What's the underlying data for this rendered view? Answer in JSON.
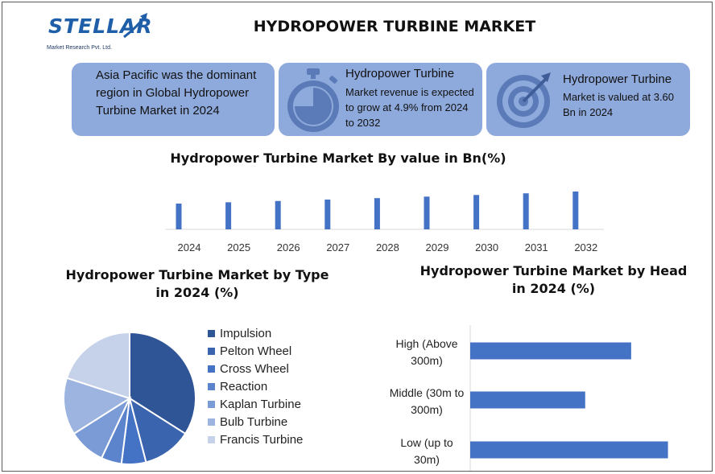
{
  "header": {
    "logo_text": "STELLAR",
    "logo_subtitle": "Market Research Pvt. Ltd.",
    "title": "HYDROPOWER TURBINE MARKET"
  },
  "cards": {
    "card1": {
      "text": "Asia Pacific was the dominant region in Global Hydropower Turbine Market in 2024"
    },
    "card2": {
      "title": "Hydropower Turbine",
      "body": "Market revenue is expected to grow at 4.9% from 2024 to 2032",
      "icon": "stopwatch-icon"
    },
    "card3": {
      "title": "Hydropower Turbine",
      "body": "Market is valued at 3.60 Bn in 2024",
      "icon": "target-arrow-icon"
    }
  },
  "colors": {
    "card_bg": "#8ea9db",
    "bar_blue": "#4472c4",
    "brand_blue": "#1f5ea8"
  },
  "chart_data": [
    {
      "type": "bar",
      "title": "Hydropower Turbine Market By value in Bn(%)",
      "categories": [
        "2024",
        "2025",
        "2026",
        "2027",
        "2028",
        "2029",
        "2030",
        "2031",
        "2032"
      ],
      "values": [
        3.6,
        3.78,
        3.96,
        4.16,
        4.36,
        4.57,
        4.8,
        5.03,
        5.28
      ],
      "ylim": [
        0,
        5.28
      ],
      "xlabel": "",
      "ylabel": "",
      "grid": false
    },
    {
      "type": "pie",
      "title": "Hydropower Turbine Market by Type in 2024 (%)",
      "labels": [
        "Impulsion",
        "Pelton Wheel",
        "Cross Wheel",
        "Reaction",
        "Kaplan Turbine",
        "Bulb Turbine",
        "Francis Turbine"
      ],
      "values": [
        34,
        12,
        6,
        5,
        9,
        14,
        20
      ],
      "colors": [
        "#2f5597",
        "#3a64ad",
        "#4472c4",
        "#5b84cc",
        "#7b9bd6",
        "#9db4e0",
        "#c5d2ea"
      ],
      "legend": "right"
    },
    {
      "type": "bar",
      "orientation": "horizontal",
      "title": "Hydropower Turbine Market by Head in 2024 (%)",
      "categories": [
        "High (Above 300m)",
        "Middle (30m to 300m)",
        "Low (up to 30m)"
      ],
      "values": [
        35,
        25,
        43
      ],
      "xlim": [
        0,
        45
      ],
      "grid": false
    }
  ]
}
